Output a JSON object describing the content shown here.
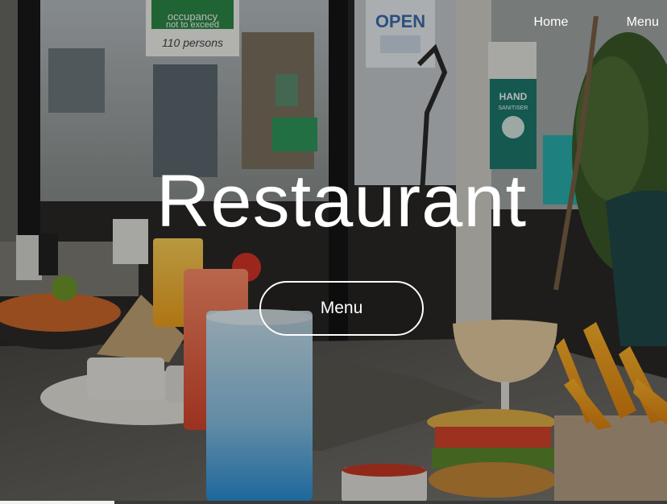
{
  "nav": {
    "home_label": "Home",
    "menu_label": "Menu"
  },
  "hero": {
    "title": "Restaurant",
    "button_label": "Menu"
  },
  "background": {
    "signs": {
      "occupancy_line1": "occupancy",
      "occupancy_line2": "not to exceed",
      "occupancy_line3": "persons",
      "occupancy_number": "110",
      "open_sign": "OPEN",
      "hand_sanitiser_1": "HAND",
      "hand_sanitiser_2": "SANITISER"
    }
  },
  "colors": {
    "text": "#ffffff",
    "button_border": "#ffffff",
    "overlay": "rgba(0,0,0,0.28)"
  }
}
